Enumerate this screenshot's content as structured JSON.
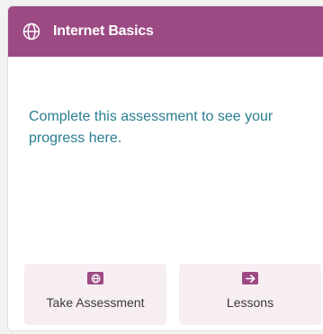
{
  "card": {
    "title": "Internet Basics",
    "title_icon": "globe-icon",
    "header_color": "#9c4a83",
    "message": "Complete this assessment to see your progress here.",
    "message_color": "#2a7d91"
  },
  "actions": {
    "take_assessment": {
      "label": "Take Assessment",
      "icon": "globe-icon"
    },
    "lessons": {
      "label": "Lessons",
      "icon": "arrow-right-icon"
    }
  }
}
